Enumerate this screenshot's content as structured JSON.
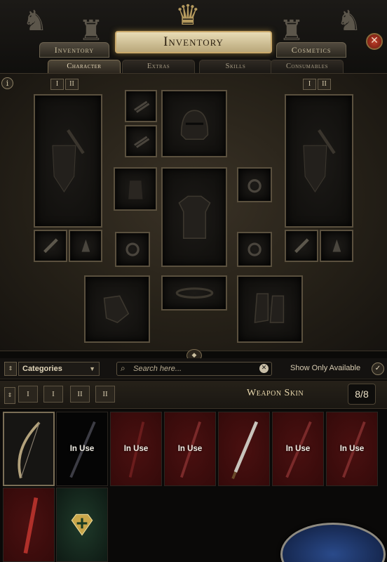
{
  "header": {
    "title": "Inventory",
    "left_tab": "Inventory",
    "right_tab": "Cosmetics",
    "close_glyph": "✕"
  },
  "subtabs": [
    {
      "label": "Character",
      "active": true
    },
    {
      "label": "Extras",
      "active": false
    },
    {
      "label": "Skills",
      "active": false
    },
    {
      "label": "Consumables",
      "active": false
    }
  ],
  "weapon_sets": {
    "left": [
      "I",
      "II"
    ],
    "right": [
      "I",
      "II"
    ]
  },
  "equipment_slots": [
    "weapon-left",
    "ring-left",
    "amulet-left",
    "helmet",
    "gloves-top",
    "body-armour",
    "belt",
    "boots",
    "weapon-right",
    "flask-left-1",
    "flask-left-2",
    "ring-right"
  ],
  "filters": {
    "categories_label": "Categories",
    "search_placeholder": "Search here...",
    "show_only_available": "Show Only Available"
  },
  "weapon_skin": {
    "title": "Weapon Skin",
    "count": "8/8",
    "set_buttons": [
      "I",
      "I",
      "II",
      "II"
    ]
  },
  "skins": [
    {
      "style": "sel",
      "in_use": false,
      "icon": "bow-icon"
    },
    {
      "style": "black",
      "in_use": true,
      "label": "In Use",
      "icon": "spear-icon"
    },
    {
      "style": "red",
      "in_use": true,
      "label": "In Use",
      "icon": "staff-icon"
    },
    {
      "style": "red",
      "in_use": true,
      "label": "In Use",
      "icon": "staff-icon"
    },
    {
      "style": "red",
      "in_use": false,
      "icon": "sword-icon"
    },
    {
      "style": "red",
      "in_use": true,
      "label": "In Use",
      "icon": "staff-icon"
    },
    {
      "style": "red",
      "in_use": true,
      "label": "In Use",
      "icon": "spear-icon"
    },
    {
      "style": "red",
      "in_use": false,
      "icon": "sword-icon"
    },
    {
      "style": "green",
      "in_use": false,
      "icon": "add-skin-icon"
    }
  ],
  "colors": {
    "in_use_bg": "#4a1010",
    "title_gold": "#ead9ae",
    "close_red": "#c2402a"
  }
}
